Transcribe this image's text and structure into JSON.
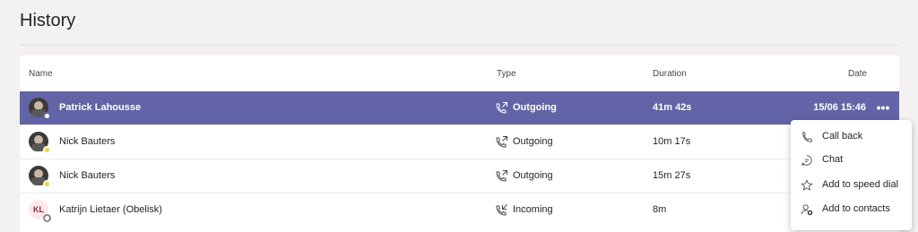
{
  "page": {
    "title": "History"
  },
  "table": {
    "headers": {
      "name": "Name",
      "type": "Type",
      "duration": "Duration",
      "date": "Date"
    },
    "rows": [
      {
        "name": "Patrick Lahousse",
        "avatar": "photo",
        "presence": "purple",
        "type": "Outgoing",
        "type_icon": "outgoing-call-icon",
        "duration": "41m 42s",
        "date": "15/06 15:46",
        "selected": true
      },
      {
        "name": "Nick Bauters",
        "avatar": "photo",
        "presence": "away",
        "type": "Outgoing",
        "type_icon": "outgoing-call-icon",
        "duration": "10m 17s",
        "date": "",
        "selected": false
      },
      {
        "name": "Nick Bauters",
        "avatar": "photo",
        "presence": "away",
        "type": "Outgoing",
        "type_icon": "outgoing-call-icon",
        "duration": "15m 27s",
        "date": "",
        "selected": false
      },
      {
        "name": "Katrijn Lietaer (Obelisk)",
        "avatar_initials": "KL",
        "presence": "offline",
        "type": "Incoming",
        "type_icon": "incoming-call-icon",
        "duration": "8m",
        "date": "",
        "selected": false
      }
    ]
  },
  "context_menu": {
    "items": [
      {
        "label": "Call back",
        "icon": "phone-icon"
      },
      {
        "label": "Chat",
        "icon": "chat-icon"
      },
      {
        "label": "Add to speed dial",
        "icon": "star-icon"
      },
      {
        "label": "Add to contacts",
        "icon": "add-contact-icon"
      }
    ]
  },
  "colors": {
    "accent": "#6264a7",
    "away": "#f8d22a"
  }
}
